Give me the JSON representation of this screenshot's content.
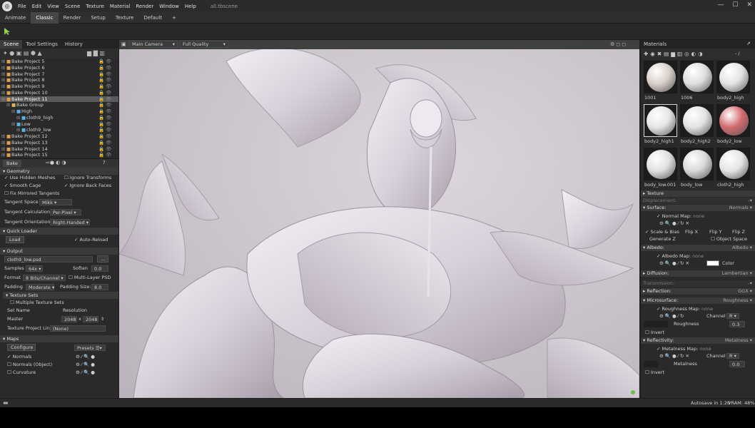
{
  "menu": {
    "items": [
      "File",
      "Edit",
      "View",
      "Scene",
      "Texture",
      "Material",
      "Render",
      "Window",
      "Help"
    ],
    "doc_title": "all.tbscene"
  },
  "tabs": [
    "Animate",
    "Classic",
    "Render",
    "Setup",
    "Texture",
    "Default",
    "+"
  ],
  "left_panel": {
    "tabs": [
      "Scene",
      "Tool Settings",
      "History"
    ],
    "tree": [
      {
        "label": "Bake Project 5",
        "indent": 0
      },
      {
        "label": "Bake Project 6",
        "indent": 0
      },
      {
        "label": "Bake Project 7",
        "indent": 0
      },
      {
        "label": "Bake Project 8",
        "indent": 0
      },
      {
        "label": "Bake Project 9",
        "indent": 0
      },
      {
        "label": "Bake Project 10",
        "indent": 0
      },
      {
        "label": "Bake Project 11",
        "indent": 0,
        "selected": true
      },
      {
        "label": "Bake Group",
        "indent": 1
      },
      {
        "label": "High",
        "indent": 2
      },
      {
        "label": "cloth9_high",
        "indent": 3
      },
      {
        "label": "Low",
        "indent": 2
      },
      {
        "label": "cloth9_low",
        "indent": 3
      },
      {
        "label": "Bake Project 12",
        "indent": 0
      },
      {
        "label": "Bake Project 13",
        "indent": 0
      },
      {
        "label": "Bake Project 14",
        "indent": 0
      },
      {
        "label": "Bake Project 15",
        "indent": 0
      }
    ],
    "props_tab": "Bake",
    "geometry": {
      "header": "Geometry",
      "use_hidden_meshes": "Use Hidden Meshes",
      "ignore_transforms": "Ignore Transforms",
      "smooth_cage": "Smooth Cage",
      "ignore_back_faces": "Ignore Back Faces",
      "fix_mirrored": "Fix Mirrored Tangents",
      "tangent_space_label": "Tangent Space",
      "tangent_space_value": "Mikk",
      "tangent_calc_label": "Tangent Calculation",
      "tangent_calc_value": "Per-Pixel",
      "tangent_orient_label": "Tangent Orientation",
      "tangent_orient_value": "Right-Handed"
    },
    "quick_loader": {
      "header": "Quick Loader",
      "load": "Load",
      "auto_reload": "Auto-Reload"
    },
    "output": {
      "header": "Output",
      "file": "cloth9_low.psd",
      "browse": "...",
      "samples_label": "Samples",
      "samples_value": "64x",
      "soften_label": "Soften",
      "soften_value": "0.0",
      "format_label": "Format",
      "format_value": "8 Bits/Channel",
      "multilayer": "Multi-Layer PSD",
      "padding_label": "Padding",
      "padding_value": "Moderate",
      "padding_size_label": "Padding Size:",
      "padding_size_value": "8.0"
    },
    "texture_sets": {
      "header": "Texture Sets",
      "multiple": "Multiple Texture Sets",
      "col_set": "Set Name",
      "col_res": "Resolution",
      "master": "Master",
      "res_w": "2048",
      "x": "x",
      "res_h": "2048",
      "link_label": "Texture Project Link",
      "link_value": "(None)"
    },
    "maps": {
      "header": "Maps",
      "configure": "Configure",
      "presets": "Presets",
      "items": [
        {
          "label": "Normals",
          "checked": true
        },
        {
          "label": "Normals (Object)",
          "checked": false
        },
        {
          "label": "Curvature",
          "checked": false
        }
      ]
    }
  },
  "viewport": {
    "camera": "Main Camera",
    "quality": "Full Quality"
  },
  "right_panel": {
    "title": "Materials",
    "zoom_label": "- /",
    "materials": [
      {
        "name": "1001",
        "color": "#d9cfc9"
      },
      {
        "name": "1006",
        "color": "#dedede"
      },
      {
        "name": "body2_high",
        "color": "#e3e3e3"
      },
      {
        "name": "body2_high1",
        "color": "#e5e5e5",
        "selected": true
      },
      {
        "name": "body2_high2",
        "color": "#e2e2e2"
      },
      {
        "name": "body2_low",
        "color": "#d36b6f"
      },
      {
        "name": "body_low.001",
        "color": "#e0e0e0"
      },
      {
        "name": "body_low",
        "color": "#d8d8d8"
      },
      {
        "name": "cloth2_high",
        "color": "#e4e4e4"
      }
    ],
    "texture_header": "Texture",
    "displacement": "Displacement:",
    "surface": {
      "header": "Surface:",
      "value": "Normals",
      "map_label": "Normal Map:",
      "map_value": "none",
      "scale_bias": "Scale & Bias",
      "flip_x": "Flip X",
      "flip_y": "Flip Y",
      "flip_z": "Flip Z",
      "generate_z": "Generate Z",
      "object_space": "Object Space"
    },
    "albedo": {
      "header": "Albedo:",
      "value": "Albedo",
      "map_label": "Albedo Map:",
      "map_value": "none",
      "color_label": "Color",
      "color": "#ffffff"
    },
    "diffusion": {
      "header": "Diffusion:",
      "value": "Lambertian"
    },
    "transmission": {
      "header": "Transmission:"
    },
    "reflection": {
      "header": "Reflection:",
      "value": "GGX"
    },
    "microsurface": {
      "header": "Microsurface:",
      "value": "Roughness",
      "map_label": "Roughness Map:",
      "map_value": "none",
      "channel_label": "Channel",
      "channel_value": "R",
      "slider_label": "Roughness",
      "slider_value": "0.3",
      "invert": "Invert"
    },
    "reflectivity": {
      "header": "Reflectivity:",
      "value": "Metalness",
      "map_label": "Metalness Map:",
      "map_value": "none",
      "channel_label": "Channel",
      "channel_value": "R",
      "slider_label": "Metalness",
      "slider_value": "0.0",
      "invert": "Invert"
    }
  },
  "status": {
    "autosave": "Autosave in 1:20",
    "vram": "VRAM: 48%"
  }
}
